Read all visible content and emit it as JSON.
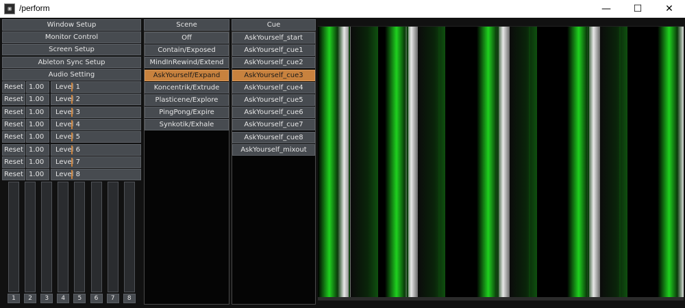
{
  "window": {
    "title": "/perform",
    "app_icon": "app-icon",
    "minimize_glyph": "—",
    "maximize_glyph": "☐",
    "close_glyph": "✕"
  },
  "setup_menu": [
    {
      "label": "Window Setup"
    },
    {
      "label": "Monitor Control"
    },
    {
      "label": "Screen Setup"
    },
    {
      "label": "Ableton Sync Setup"
    },
    {
      "label": "Audio Setting"
    }
  ],
  "channels": [
    {
      "reset": "Reset",
      "value": "1.00",
      "level": "Level 1"
    },
    {
      "reset": "Reset",
      "value": "1.00",
      "level": "Level 2"
    },
    {
      "reset": "Reset",
      "value": "1.00",
      "level": "Level 3"
    },
    {
      "reset": "Reset",
      "value": "1.00",
      "level": "Level 4"
    },
    {
      "reset": "Reset",
      "value": "1.00",
      "level": "Level 5"
    },
    {
      "reset": "Reset",
      "value": "1.00",
      "level": "Level 6"
    },
    {
      "reset": "Reset",
      "value": "1.00",
      "level": "Level 7"
    },
    {
      "reset": "Reset",
      "value": "1.00",
      "level": "Level 8"
    }
  ],
  "faders": [
    "1",
    "2",
    "3",
    "4",
    "5",
    "6",
    "7",
    "8"
  ],
  "scene": {
    "header": "Scene",
    "items": [
      "Off",
      "Contain/Exposed",
      "MindInRewind/Extend",
      "AskYourself/Expand",
      "Koncentrik/Extrude",
      "Plasticene/Explore",
      "PingPong/Expire",
      "Synkotik/Exhale"
    ],
    "selected": "AskYourself/Expand"
  },
  "cue": {
    "header": "Cue",
    "items": [
      "AskYourself_start",
      "AskYourself_cue1",
      "AskYourself_cue2",
      "AskYourself_cue3",
      "AskYourself_cue4",
      "AskYourself_cue5",
      "AskYourself_cue6",
      "AskYourself_cue7",
      "AskYourself_cue8",
      "AskYourself_mixout"
    ],
    "selected": "AskYourself_cue3"
  },
  "colors": {
    "accent": "#c8823e",
    "button": "#474b50",
    "background": "#111111",
    "stripe_green": "#1fd11f",
    "stripe_white": "#e8e8e8"
  }
}
